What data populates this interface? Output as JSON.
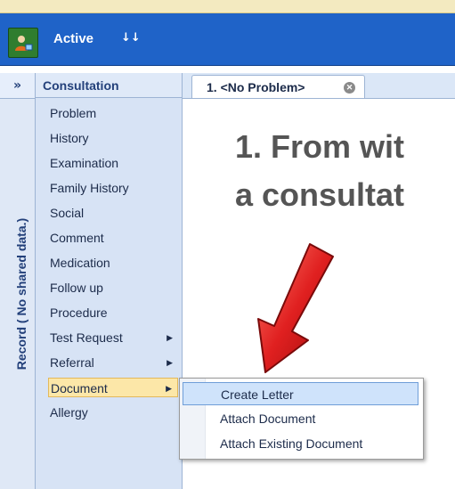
{
  "toolbar": {
    "active_label": "Active",
    "expand_icon": "double-chevron-down-icon",
    "user_icon": "user-status-icon"
  },
  "left_strip": {
    "collapse_label": "»",
    "vertical_label": "Record ( No shared data.)"
  },
  "consultation": {
    "title": "Consultation",
    "items": [
      {
        "label": "Problem",
        "has_submenu": false
      },
      {
        "label": "History",
        "has_submenu": false
      },
      {
        "label": "Examination",
        "has_submenu": false
      },
      {
        "label": "Family History",
        "has_submenu": false
      },
      {
        "label": "Social",
        "has_submenu": false
      },
      {
        "label": "Comment",
        "has_submenu": false
      },
      {
        "label": "Medication",
        "has_submenu": false
      },
      {
        "label": "Follow up",
        "has_submenu": false
      },
      {
        "label": "Procedure",
        "has_submenu": false
      },
      {
        "label": "Test Request",
        "has_submenu": true
      },
      {
        "label": "Referral",
        "has_submenu": true
      },
      {
        "label": "Document",
        "has_submenu": true,
        "selected": true
      },
      {
        "label": "Allergy",
        "has_submenu": false
      }
    ]
  },
  "tab": {
    "label": "1. <No Problem>",
    "close_icon": "close-icon"
  },
  "annotation": {
    "line1": "1. From wit",
    "line2": "a consultat"
  },
  "submenu": {
    "items": [
      {
        "label": "Create Letter",
        "highlighted": true
      },
      {
        "label": "Attach Document"
      },
      {
        "label": "Attach Existing Document"
      }
    ]
  },
  "colors": {
    "toolbar": "#1f63c8",
    "panel": "#d7e3f5",
    "arrow": "#e02020",
    "selected_item": "#fce7a8"
  }
}
